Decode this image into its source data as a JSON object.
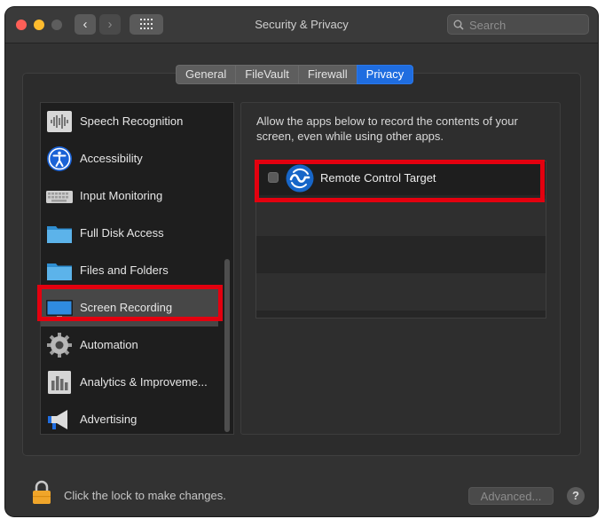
{
  "window": {
    "title": "Security & Privacy",
    "search_placeholder": "Search"
  },
  "toolbar": {
    "back_glyph": "‹",
    "forward_glyph": "›"
  },
  "tabs": [
    {
      "label": "General",
      "active": false
    },
    {
      "label": "FileVault",
      "active": false
    },
    {
      "label": "Firewall",
      "active": false
    },
    {
      "label": "Privacy",
      "active": true
    }
  ],
  "sidebar": {
    "items": [
      {
        "label": "Speech Recognition",
        "icon": "waveform-icon"
      },
      {
        "label": "Accessibility",
        "icon": "accessibility-icon"
      },
      {
        "label": "Input Monitoring",
        "icon": "keyboard-icon"
      },
      {
        "label": "Full Disk Access",
        "icon": "folder-icon"
      },
      {
        "label": "Files and Folders",
        "icon": "folder-icon"
      },
      {
        "label": "Screen Recording",
        "icon": "display-icon",
        "selected": true
      },
      {
        "label": "Automation",
        "icon": "gear-icon"
      },
      {
        "label": "Analytics & Improveme...",
        "icon": "bar-chart-icon"
      },
      {
        "label": "Advertising",
        "icon": "megaphone-icon"
      }
    ]
  },
  "content": {
    "description": "Allow the apps below to record the contents of your screen, even while using other apps.",
    "apps": [
      {
        "name": "Remote Control Target",
        "checked": false,
        "icon": "remote-control-icon"
      }
    ]
  },
  "footer": {
    "lock_text": "Click the lock to make changes.",
    "advanced_label": "Advanced...",
    "help_label": "?"
  },
  "colors": {
    "accent": "#1f6de0",
    "highlight": "#e3000f",
    "window_bg": "#323232"
  }
}
